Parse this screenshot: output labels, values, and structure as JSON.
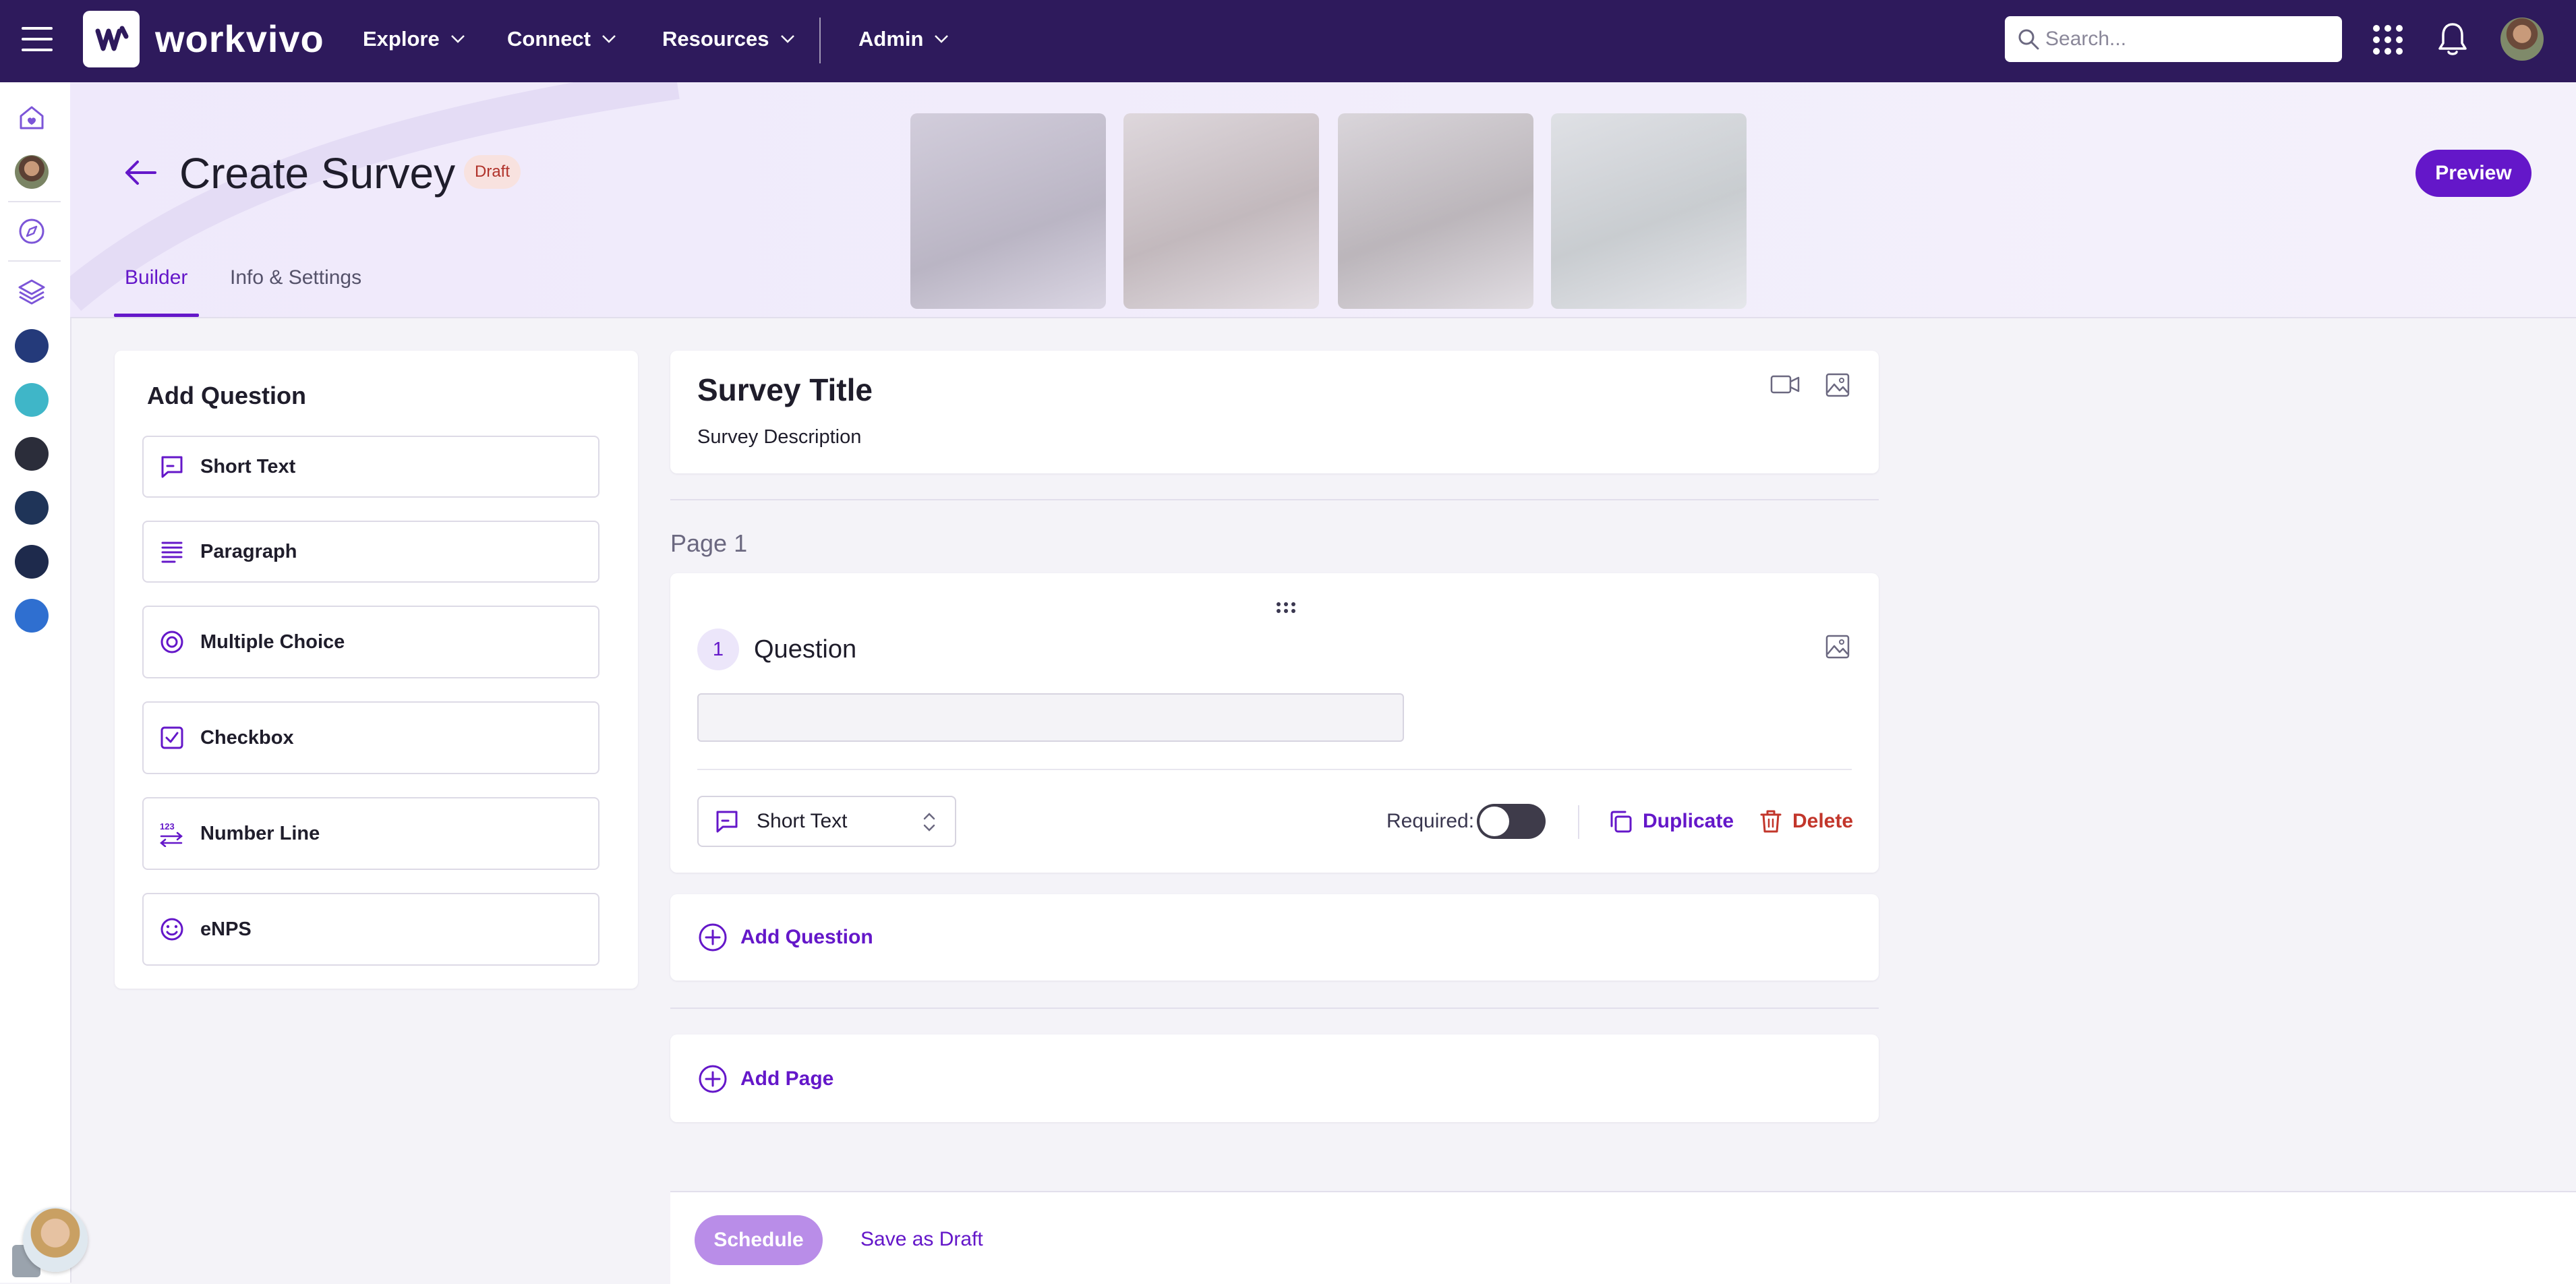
{
  "brand": {
    "name": "workvivo",
    "accent": "#6417c9",
    "topbar": "#2e1a5c"
  },
  "nav": {
    "items": [
      {
        "label": "Explore"
      },
      {
        "label": "Connect"
      },
      {
        "label": "Resources"
      },
      {
        "label": "Admin"
      }
    ],
    "search_placeholder": "Search..."
  },
  "rail": {
    "icons": [
      "home-icon",
      "profile-avatar",
      "compass-icon",
      "layers-icon",
      "space-avatar",
      "space-avatar",
      "space-avatar",
      "space-avatar",
      "space-avatar",
      "space-avatar"
    ]
  },
  "header": {
    "title": "Create Survey",
    "status_badge": "Draft",
    "preview_label": "Preview",
    "tabs": [
      {
        "label": "Builder",
        "active": true
      },
      {
        "label": "Info & Settings",
        "active": false
      }
    ]
  },
  "add_question": {
    "title": "Add Question",
    "types": [
      {
        "label": "Short Text",
        "icon": "message-square-icon"
      },
      {
        "label": "Paragraph",
        "icon": "paragraph-icon"
      },
      {
        "label": "Multiple Choice",
        "icon": "radio-icon"
      },
      {
        "label": "Checkbox",
        "icon": "checkbox-icon"
      },
      {
        "label": "Number Line",
        "icon": "number-line-icon"
      },
      {
        "label": "eNPS",
        "icon": "smiley-icon"
      }
    ]
  },
  "survey": {
    "title": "Survey Title",
    "description": "Survey Description",
    "page_label": "Page 1",
    "question": {
      "number": "1",
      "label": "Question",
      "input_value": "",
      "type_selected": "Short Text",
      "required_label": "Required:",
      "required": false,
      "duplicate_label": "Duplicate",
      "delete_label": "Delete"
    },
    "add_question_label": "Add Question",
    "add_page_label": "Add Page"
  },
  "footer": {
    "schedule_label": "Schedule",
    "save_draft_label": "Save as Draft"
  },
  "colors": {
    "delete": "#c2362b",
    "badge_bg": "#f8e2df"
  }
}
